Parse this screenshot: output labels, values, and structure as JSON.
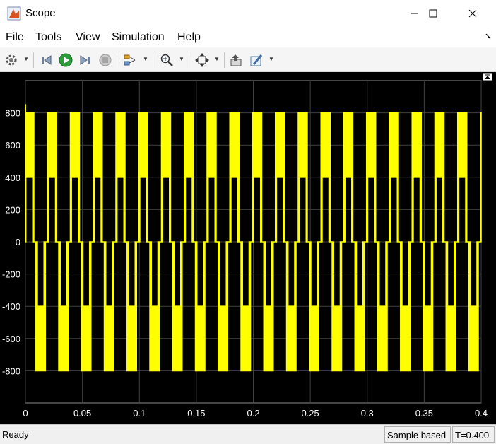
{
  "window": {
    "title": "Scope"
  },
  "menu": {
    "items": [
      "File",
      "Tools",
      "View",
      "Simulation",
      "Help"
    ]
  },
  "toolbar": {
    "buttons": [
      "settings-icon",
      "step-back-icon",
      "run-icon",
      "step-forward-icon",
      "stop-icon",
      "signal-selector-icon",
      "zoom-icon",
      "autoscale-icon",
      "highlight-block-icon",
      "style-icon"
    ]
  },
  "colors": {
    "plot_bg": "#000000",
    "axes_bg": "#000000",
    "trace": "#ffff00",
    "grid": "#404040",
    "tick_text": "#ffffff"
  },
  "chart_data": {
    "type": "line",
    "title": "",
    "xlabel": "",
    "ylabel": "",
    "xlim": [
      0,
      0.4
    ],
    "ylim": [
      -1000,
      1000
    ],
    "xticks": [
      "0",
      "0.05",
      "0.1",
      "0.15",
      "0.2",
      "0.25",
      "0.3",
      "0.35",
      "0.4"
    ],
    "yticks": [
      "800",
      "600",
      "400",
      "200",
      "0",
      "-200",
      "-400",
      "-600",
      "-800"
    ],
    "grid": true,
    "series": [
      {
        "style": "stepped PWM line-to-line voltage, levels ±800, ±400, 0; fundamental period 0.02",
        "levels": [
          -800,
          -400,
          0,
          400,
          800
        ],
        "fundamental_period": 0.02,
        "initial_spike": 850
      }
    ]
  },
  "status": {
    "left": "Ready",
    "mode": "Sample based",
    "time": "T=0.400"
  }
}
